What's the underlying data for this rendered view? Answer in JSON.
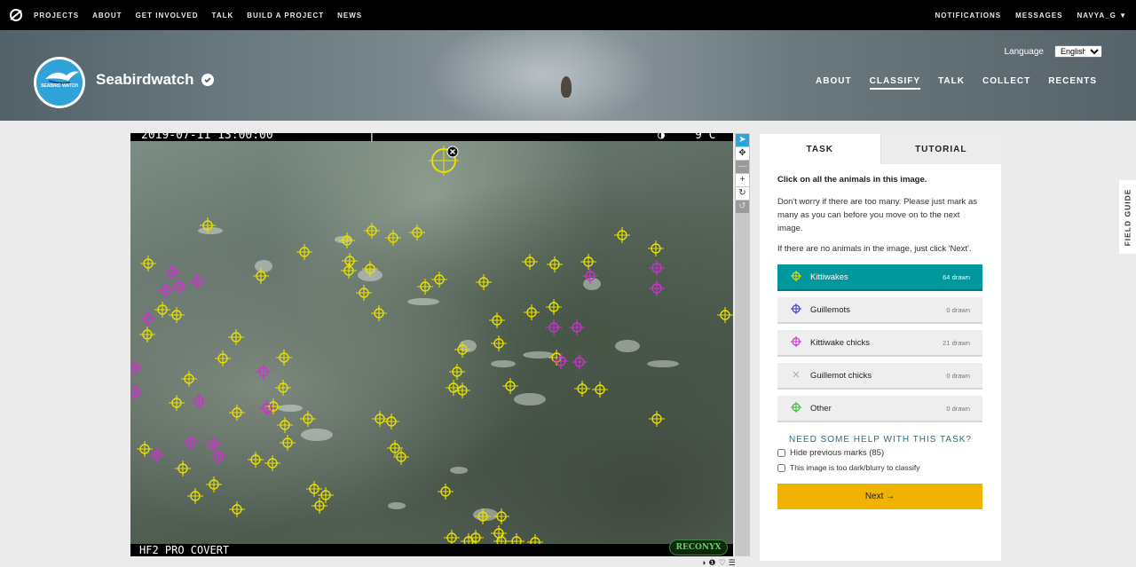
{
  "topnav": {
    "links": [
      "PROJECTS",
      "ABOUT",
      "GET INVOLVED",
      "TALK",
      "BUILD A PROJECT",
      "NEWS"
    ],
    "notifications": "NOTIFICATIONS",
    "messages": "MESSAGES",
    "user": "NAVYA_G"
  },
  "project": {
    "name": "Seabirdwatch",
    "logo_text": "SEABIRD WATCH",
    "language_label": "Language",
    "language_value": "English",
    "nav": [
      "ABOUT",
      "CLASSIFY",
      "TALK",
      "COLLECT",
      "RECENTS"
    ],
    "active_nav": "CLASSIFY"
  },
  "subject": {
    "timestamp": "2019-07-11 13:00:00",
    "temperature": "9°C",
    "camera_model": "HF2 PRO COVERT",
    "brand": "RECONYX"
  },
  "viewer_tools": [
    "pointer",
    "move",
    "zoom-out",
    "zoom-in",
    "rotate",
    "reset"
  ],
  "task": {
    "tabs": [
      "TASK",
      "TUTORIAL"
    ],
    "instruction": "Click on all the animals in this image.",
    "help1": "Don't worry if there are too many. Please just mark as many as you can before you move on to the next image.",
    "help2": "If there are no animals in the image, just click 'Next'.",
    "tools": [
      {
        "label": "Kittiwakes",
        "count": "64 drawn",
        "color": "#e8e000"
      },
      {
        "label": "Guillemots",
        "count": "0 drawn",
        "color": "#3a3ad0"
      },
      {
        "label": "Kittiwake chicks",
        "count": "21 drawn",
        "color": "#d030d0"
      },
      {
        "label": "Guillemot chicks",
        "count": "0 drawn",
        "color": "#9a9a9a"
      },
      {
        "label": "Other",
        "count": "0 drawn",
        "color": "#30c030"
      }
    ],
    "need_help": "NEED SOME HELP WITH THIS TASK?",
    "hide_marks": "Hide previous marks (85)",
    "too_dark": "This image is too dark/blurry to classify",
    "next": "Next →"
  },
  "field_guide": "FIELD GUIDE",
  "colors": {
    "kittiwake": "#e8e000",
    "chick": "#d030d0",
    "selected_tool": "#00979d",
    "next": "#f0b200"
  }
}
